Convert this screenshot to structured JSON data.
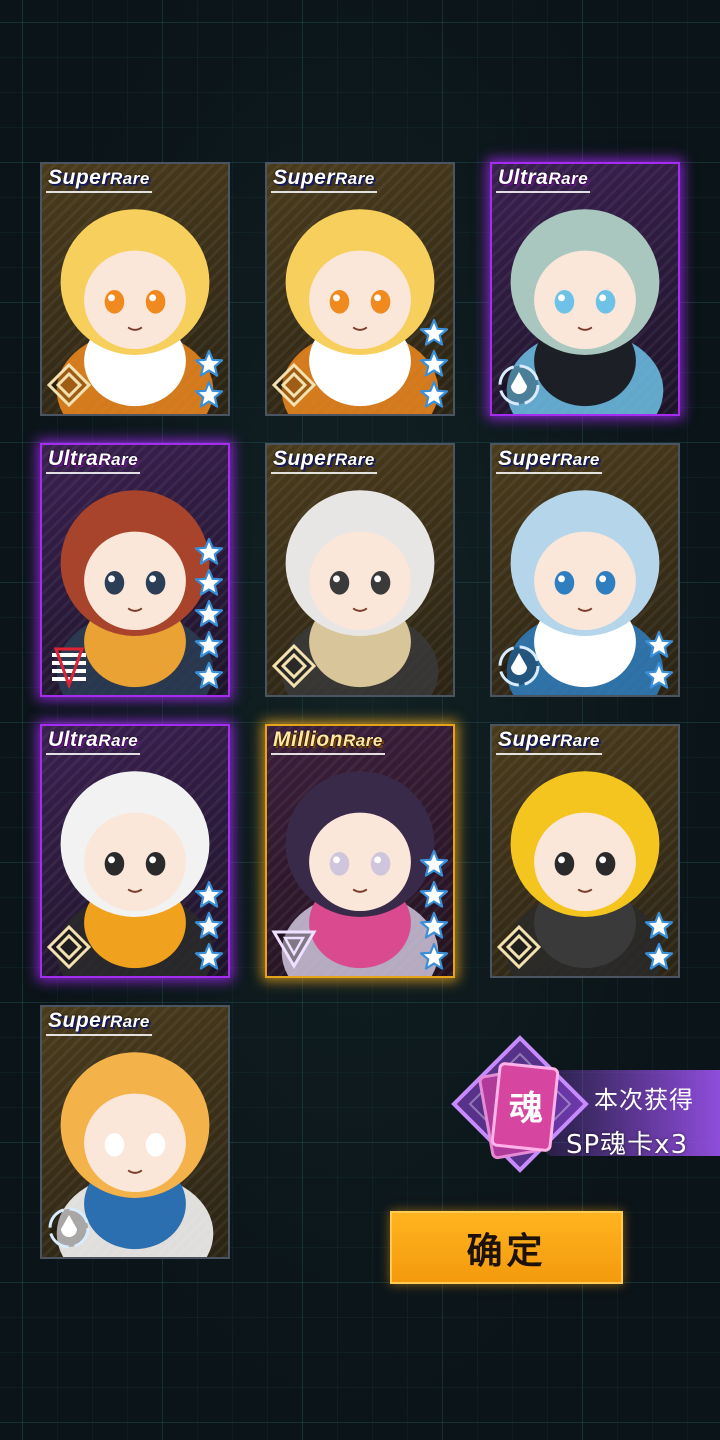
{
  "cards": [
    {
      "rarity_main": "Super",
      "rarity_sub": "Rare",
      "tier": "super",
      "stars": 2,
      "element": "diamond",
      "palette": [
        "#f6cf5c",
        "#ffffff",
        "#f08a1e"
      ]
    },
    {
      "rarity_main": "Super",
      "rarity_sub": "Rare",
      "tier": "super",
      "stars": 3,
      "element": "diamond",
      "palette": [
        "#f6cf5c",
        "#ffffff",
        "#f08a1e"
      ]
    },
    {
      "rarity_main": "Ultra",
      "rarity_sub": "Rare",
      "tier": "ultra",
      "stars": 0,
      "element": "drop",
      "palette": [
        "#a9c7bf",
        "#1c2026",
        "#6ec2e8"
      ]
    },
    {
      "rarity_main": "Ultra",
      "rarity_sub": "Rare",
      "tier": "ultra",
      "stars": 5,
      "element": "stripes",
      "palette": [
        "#a8442c",
        "#e9a233",
        "#2b3e55"
      ]
    },
    {
      "rarity_main": "Super",
      "rarity_sub": "Rare",
      "tier": "super",
      "stars": 0,
      "element": "diamond",
      "palette": [
        "#e8e6e4",
        "#d9c59a",
        "#3a3a3a"
      ]
    },
    {
      "rarity_main": "Super",
      "rarity_sub": "Rare",
      "tier": "super",
      "stars": 2,
      "element": "drop",
      "palette": [
        "#b4d5ea",
        "#ffffff",
        "#2f7fc0"
      ]
    },
    {
      "rarity_main": "Ultra",
      "rarity_sub": "Rare",
      "tier": "ultra",
      "stars": 3,
      "element": "diamond",
      "palette": [
        "#f2f2f2",
        "#f0a11d",
        "#2a2a2a"
      ]
    },
    {
      "rarity_main": "Million",
      "rarity_sub": "Rare",
      "tier": "million",
      "stars": 4,
      "element": "triangle",
      "palette": [
        "#3a2a4a",
        "#d94b8e",
        "#cfc5dc"
      ]
    },
    {
      "rarity_main": "Super",
      "rarity_sub": "Rare",
      "tier": "super",
      "stars": 2,
      "element": "diamond",
      "palette": [
        "#f4c51e",
        "#3a3a3a",
        "#2a2a2a"
      ]
    },
    {
      "rarity_main": "Super",
      "rarity_sub": "Rare",
      "tier": "super",
      "stars": 0,
      "element": "drop",
      "palette": [
        "#f3b24a",
        "#2b6fb0",
        "#ffffff"
      ]
    }
  ],
  "reward": {
    "icon_glyph": "魂",
    "title": "本次获得",
    "count": "SP魂卡x3"
  },
  "confirm_label": "确定",
  "colors": {
    "super_border": "#4b5561",
    "ultra_border": "#a52df0",
    "million_border": "#e6a21a",
    "button": "#ffb41f",
    "star": "#ffffff",
    "star_outline": "#3a8fd8"
  }
}
